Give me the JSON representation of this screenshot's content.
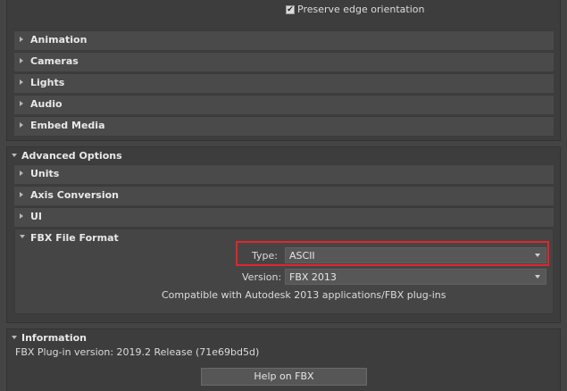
{
  "top": {
    "preserve_edge": {
      "label": "Preserve edge orientation",
      "checked": true,
      "check_glyph": "✔"
    }
  },
  "collapsed_rollouts": [
    {
      "label": "Animation"
    },
    {
      "label": "Cameras"
    },
    {
      "label": "Lights"
    },
    {
      "label": "Audio"
    },
    {
      "label": "Embed Media"
    }
  ],
  "advanced": {
    "title": "Advanced Options",
    "rollouts": [
      {
        "label": "Units"
      },
      {
        "label": "Axis Conversion"
      },
      {
        "label": "UI"
      }
    ],
    "fbx_file_format": {
      "title": "FBX File Format",
      "type_label": "Type:",
      "type_value": "ASCII",
      "version_label": "Version:",
      "version_value": "FBX 2013",
      "compat_text": "Compatible with Autodesk 2013 applications/FBX plug-ins"
    }
  },
  "information": {
    "title": "Information",
    "version_text": "FBX Plug-in version: 2019.2 Release (71e69bd5d)",
    "help_button": "Help on FBX"
  },
  "colors": {
    "highlight": "#e0262c",
    "panel": "#3d3d3d",
    "rollout": "#4a4a4a"
  }
}
